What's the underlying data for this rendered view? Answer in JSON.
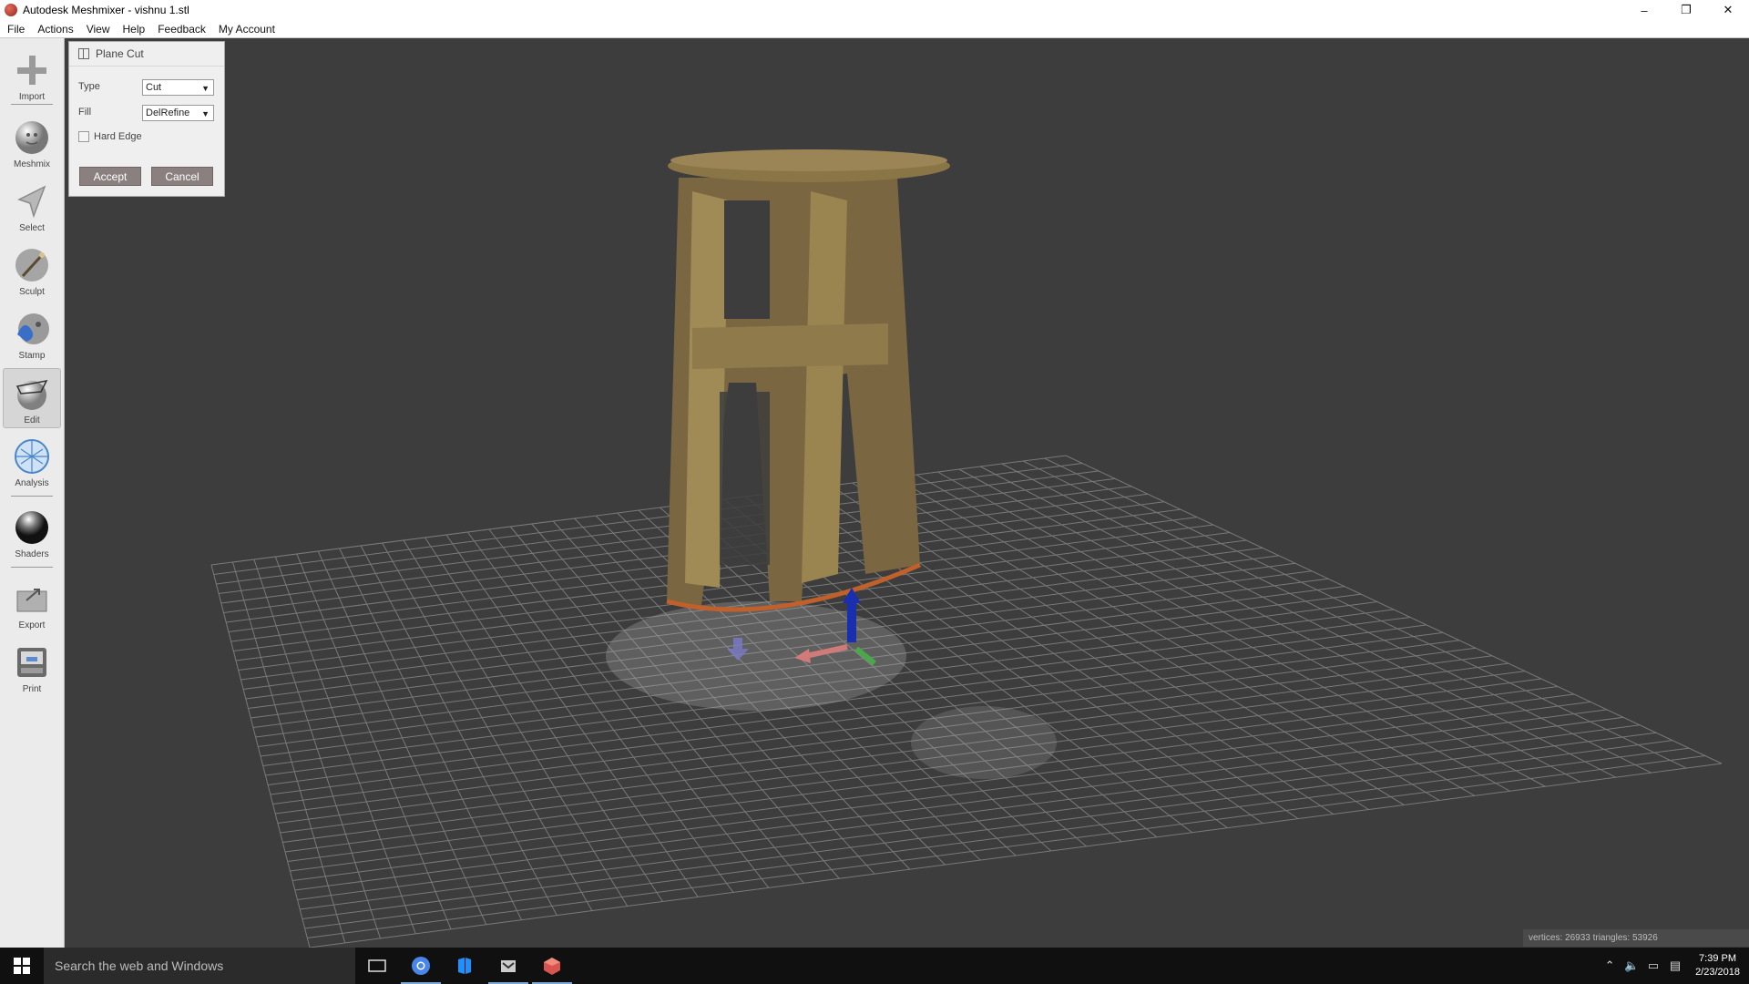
{
  "window": {
    "title": "Autodesk Meshmixer - vishnu 1.stl",
    "controls": {
      "minimize": "–",
      "restore": "❐",
      "close": "✕"
    }
  },
  "menu": [
    "File",
    "Actions",
    "View",
    "Help",
    "Feedback",
    "My Account"
  ],
  "tools": [
    {
      "label": "Import",
      "icon": "import-icon"
    },
    {
      "label": "Meshmix",
      "icon": "meshmix-icon"
    },
    {
      "label": "Select",
      "icon": "select-icon"
    },
    {
      "label": "Sculpt",
      "icon": "sculpt-icon"
    },
    {
      "label": "Stamp",
      "icon": "stamp-icon"
    },
    {
      "label": "Edit",
      "icon": "edit-icon",
      "active": true
    },
    {
      "label": "Analysis",
      "icon": "analysis-icon"
    },
    {
      "label": "Shaders",
      "icon": "shaders-icon"
    },
    {
      "label": "Export",
      "icon": "export-icon"
    },
    {
      "label": "Print",
      "icon": "print-icon"
    }
  ],
  "plane_cut": {
    "title": "Plane Cut",
    "type_label": "Type",
    "type_value": "Cut",
    "fill_label": "Fill",
    "fill_value": "DelRefine",
    "hard_edge_label": "Hard Edge",
    "hard_edge_checked": false,
    "accept_label": "Accept",
    "cancel_label": "Cancel"
  },
  "status": {
    "text": "vertices: 26933 triangles: 53926"
  },
  "taskbar": {
    "search_placeholder": "Search the web and Windows",
    "time": "7:39 PM",
    "date": "2/23/2018"
  },
  "colors": {
    "viewport_bg": "#3d3d3d",
    "grid": "#9a9a9a",
    "model": "#8a7546",
    "toolbar_bg": "#ebebeb",
    "button_bg": "#8b8080"
  }
}
